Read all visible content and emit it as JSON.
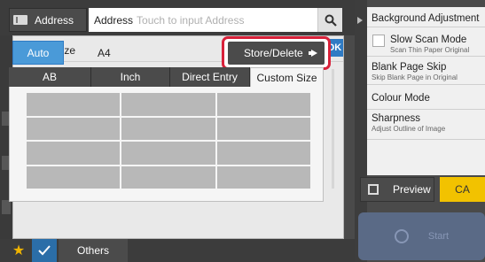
{
  "header": {
    "address_button": "Address",
    "address_label": "Address",
    "address_placeholder": "Touch to input Address"
  },
  "right_panel": {
    "items": [
      {
        "title": "Background Adjustment",
        "sub": ""
      },
      {
        "title": "Slow Scan Mode",
        "sub": "Scan Thin Paper Original",
        "checkbox": true
      },
      {
        "title": "Blank Page Skip",
        "sub": "Skip Blank Page in Original"
      },
      {
        "title": "Colour Mode",
        "sub": ""
      },
      {
        "title": "Sharpness",
        "sub": "Adjust Outline of Image"
      }
    ],
    "preview_label": "Preview",
    "ca_label": "CA",
    "start_label": "Start"
  },
  "footer": {
    "others_label": "Others"
  },
  "modal": {
    "title": "Scan Size",
    "ok_label": "OK",
    "auto_label": "Auto",
    "size_value": "A4",
    "store_label": "Store/Delete",
    "tabs": [
      {
        "label": "AB",
        "active": false
      },
      {
        "label": "Inch",
        "active": false
      },
      {
        "label": "Direct Entry",
        "active": false
      },
      {
        "label": "Custom Size",
        "active": true
      }
    ]
  },
  "colors": {
    "accent_blue": "#4a9ad8",
    "ok_blue": "#2f7bc4",
    "highlight_red": "#d8213a",
    "ca_yellow": "#f2c200"
  }
}
